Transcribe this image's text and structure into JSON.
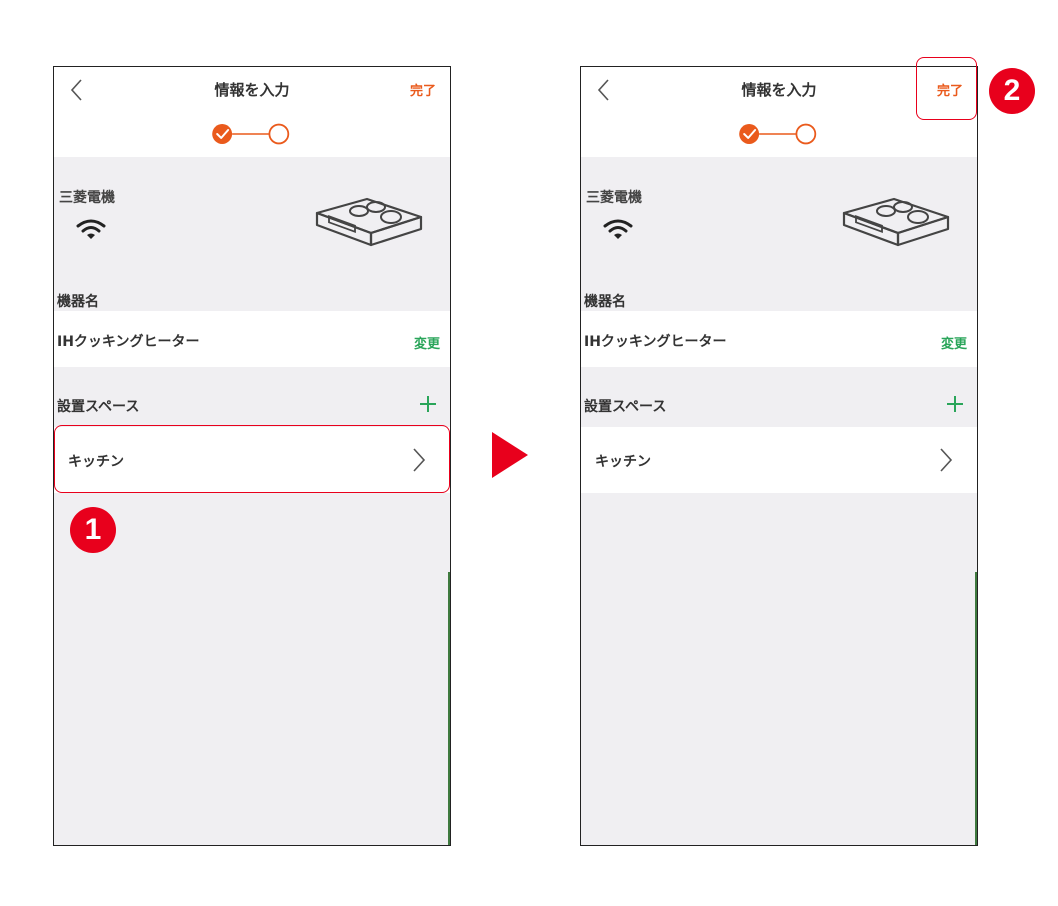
{
  "colors": {
    "accent": "#ea5a1c",
    "green": "#2aa55a",
    "highlight": "#e8001c",
    "background": "#f0eff2"
  },
  "screen": {
    "title": "情報を入力",
    "done_label": "完了",
    "back_icon": "chevron-left-icon",
    "steps": {
      "total": 2,
      "current": 1
    },
    "maker": "三菱電機",
    "wifi_icon": "wifi-icon",
    "device_icon": "ih-cooktop-icon",
    "device_name_label": "機器名",
    "device_name": "IHクッキングヒーター",
    "change_label": "変更",
    "space_label": "設置スペース",
    "add_icon": "plus-icon",
    "space_item": "キッチン",
    "chevron_icon": "chevron-right-icon"
  },
  "annotations": {
    "badge_1": "1",
    "badge_2": "2",
    "arrow_icon": "arrow-right-icon"
  }
}
